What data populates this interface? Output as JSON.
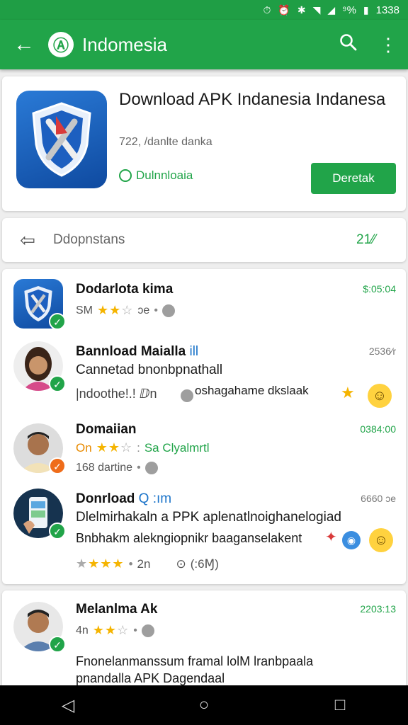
{
  "status_bar": {
    "battery": "⁹%",
    "time": "1338"
  },
  "app_bar": {
    "title": "Indomesia"
  },
  "hero": {
    "title": "Download APK Indanesia Indanesa",
    "subtitle": "722, /danlte danka",
    "status": "Dulnnloaia",
    "button": "Deretak"
  },
  "downloads_row": {
    "label": "Ddopnstans",
    "count": "21⁄⁄"
  },
  "items": [
    {
      "name": "Dodarlota kima",
      "time": "$:05:04",
      "meta": "SM",
      "stars": "★★",
      "stars_off": "☆",
      "meta2": "ɔe"
    },
    {
      "name": "Bannload Maialla",
      "name_accent": "ill",
      "time": "2536⁄r",
      "line1": "Cannetad bnonbpnathall",
      "line2": "|ndoothe!.! ⅅn",
      "line3": "oshagahame dkslaak"
    },
    {
      "name": "Domaiian",
      "time": "0384:00",
      "meta_a": "On",
      "stars": "★★",
      "stars_off": "☆",
      "meta_b": "Sa Clyalmrtl",
      "meta2": "168 dartine"
    },
    {
      "name": "Donrload",
      "name_accent": "Q :ım",
      "time": "6660 ɔe",
      "line1": "Dlelmirhakaln a PPK aplenatlnoighanelogiad",
      "line2": "Bnbhakm alekngiopnikr baaganselakent",
      "rating_tail": "2n",
      "rating_info": "(:6Ɱ)"
    },
    {
      "name": "Melanlma Ak",
      "time": "2203:13",
      "meta": "4n",
      "stars": "★★",
      "stars_off": "☆",
      "line1": "Fnonelanmanssum framal lolM lranbpaala",
      "line2": "pnandalla APK Dagendaal"
    }
  ]
}
